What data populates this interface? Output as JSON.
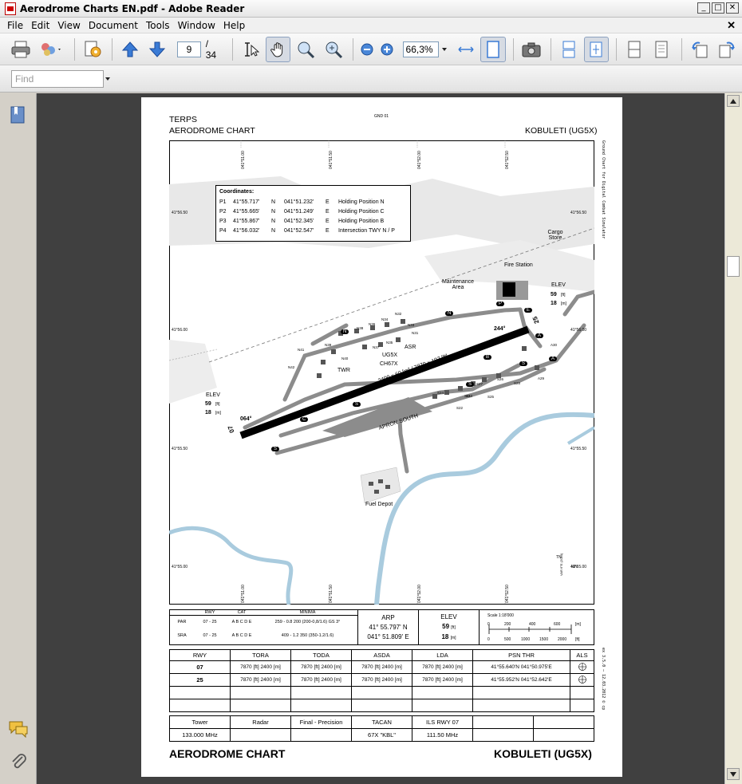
{
  "window": {
    "title": "Aerodrome Charts EN.pdf - Adobe Reader"
  },
  "menu": [
    "File",
    "Edit",
    "View",
    "Document",
    "Tools",
    "Window",
    "Help"
  ],
  "toolbar": {
    "page_current": "9",
    "page_total": "/ 34",
    "zoom": "66,3%"
  },
  "find": {
    "placeholder": "Find"
  },
  "chart": {
    "org": "TERPS",
    "type_title": "AERODROME CHART",
    "code": "GND 01",
    "airport": "KOBULETI (UG5X)",
    "side_note": "Ground Chart for Digital Combat Simulator",
    "side_footer": "ex 3.5.0 — 12.03.2012 © cp",
    "lon_labels": [
      "041°51.00",
      "041°51.50",
      "041°52.00",
      "041°52.50"
    ],
    "lat_labels": [
      "41°56.50",
      "41°56.00",
      "41°55.50",
      "41°55.00"
    ],
    "coords_title": "Coordinates:",
    "coords": [
      {
        "id": "P1",
        "lat": "41°55.717'",
        "ns": "N",
        "lon": "041°51.232'",
        "ew": "E",
        "desc": "Holding Position N"
      },
      {
        "id": "P2",
        "lat": "41°55.665'",
        "ns": "N",
        "lon": "041°51.249'",
        "ew": "E",
        "desc": "Holding Position C"
      },
      {
        "id": "P3",
        "lat": "41°55.867'",
        "ns": "N",
        "lon": "041°52.345'",
        "ew": "E",
        "desc": "Holding Position B"
      },
      {
        "id": "P4",
        "lat": "41°56.032'",
        "ns": "N",
        "lon": "041°52.547'",
        "ew": "E",
        "desc": "Intersection TWY N / P"
      }
    ],
    "labels": {
      "cargo": "Cargo Store",
      "fire": "Fire Station",
      "maint": "Maintenance Area",
      "elev_title": "ELEV",
      "elev_ft": "59",
      "elev_m": "18",
      "ft": "[ft]",
      "m": "[m]",
      "asr": "ASR",
      "ug5x": "UG5X",
      "tacan": "CH67X",
      "twr": "TWR",
      "runway": "2400 x 60 [m] / 7870 x 197 [ft]",
      "apron": "APRON SOUTH",
      "fuel": "Fuel Depot",
      "hdg_w": "064°",
      "hdg_e": "244°",
      "rwy_w": "07",
      "rwy_e": "25",
      "tn": "TN",
      "mn": "MN",
      "var": "VAR 6°E (2010)"
    },
    "twy_letters": [
      "N",
      "N",
      "P",
      "E",
      "A",
      "A",
      "B",
      "S",
      "S",
      "S",
      "C",
      "S"
    ],
    "stands": [
      "N31",
      "N32",
      "N33",
      "N34",
      "N35",
      "N36",
      "N37",
      "N38",
      "N39",
      "N40",
      "N41",
      "N42",
      "A29",
      "A30",
      "S21",
      "S22",
      "S23",
      "S24",
      "S25",
      "S26",
      "S27",
      "S28"
    ],
    "minima": {
      "head": [
        "RWY",
        "CAT",
        "MINIMA"
      ],
      "rows": [
        [
          "PAR",
          "07 - 25",
          "A B C D E",
          "259 - 0.8 200 (200-0,8/1.6) GS 3°"
        ],
        [
          "SRA",
          "07 - 25",
          "A B C D E",
          "409 - 1.2 350 (350-1.2/1.6)"
        ]
      ]
    },
    "arp": {
      "title": "ARP",
      "lat": "41° 55.797' N",
      "lon": "041° 51.809' E"
    },
    "elev_box": {
      "title": "ELEV",
      "ft": "59",
      "m": "18"
    },
    "scale": {
      "title": "Scale 1:18'000",
      "m_ticks": [
        "0",
        "200",
        "400",
        "600"
      ],
      "ft_ticks": [
        "0",
        "500",
        "1000",
        "1500",
        "2000"
      ],
      "m_unit": "[m]",
      "ft_unit": "[ft]"
    },
    "rwy_table": {
      "head": [
        "RWY",
        "TORA",
        "TODA",
        "ASDA",
        "LDA",
        "PSN THR",
        "ALS"
      ],
      "rows": [
        [
          "07",
          "7870 [ft] 2400 [m]",
          "7870 [ft] 2400 [m]",
          "7870 [ft] 2400 [m]",
          "7870 [ft] 2400 [m]",
          "41°55.640'N 041°50.975'E"
        ],
        [
          "25",
          "7870 [ft] 2400 [m]",
          "7870 [ft] 2400 [m]",
          "7870 [ft] 2400 [m]",
          "7870 [ft] 2400 [m]",
          "41°55.952'N 041°52.642'E"
        ]
      ]
    },
    "freq_table": {
      "head": [
        "Tower",
        "Radar",
        "Final - Precision",
        "TACAN",
        "ILS RWY 07",
        "",
        ""
      ],
      "vals": [
        "133.000 MHz",
        "",
        "",
        "67X \"KBL\"",
        "111.50 MHz",
        "",
        ""
      ]
    }
  },
  "colors": {
    "river": "#a9cbde",
    "terrain": "#e8e8e8",
    "taxiway": "#8c8c8c",
    "runway": "#000000"
  }
}
